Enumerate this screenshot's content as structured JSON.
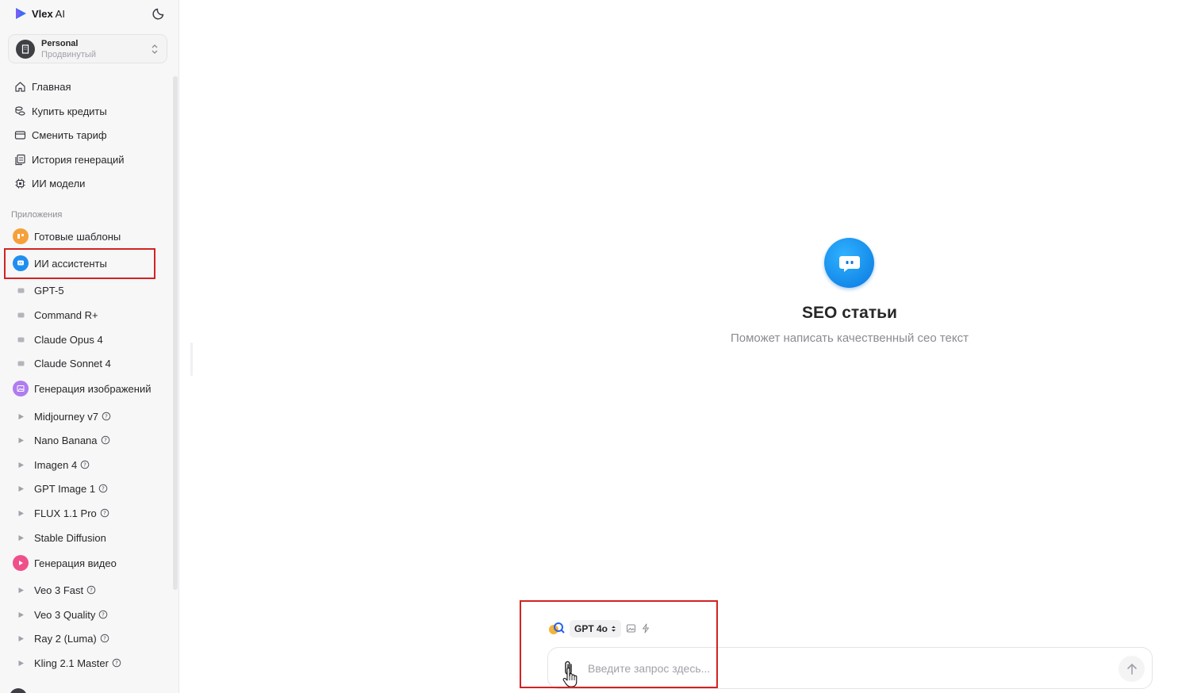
{
  "brand": {
    "name": "Vlex",
    "suffix": " AI"
  },
  "account": {
    "name": "Personal",
    "plan": "Продвинутый"
  },
  "nav": [
    {
      "label": "Главная",
      "icon": "home-icon"
    },
    {
      "label": "Купить кредиты",
      "icon": "coins-icon"
    },
    {
      "label": "Сменить тариф",
      "icon": "card-icon"
    },
    {
      "label": "История генераций",
      "icon": "history-icon"
    },
    {
      "label": "ИИ модели",
      "icon": "chip-icon"
    }
  ],
  "apps": {
    "section_label": "Приложения",
    "templates": {
      "label": "Готовые шаблоны",
      "color": "#f5a03a"
    },
    "assistants": {
      "label": "ИИ ассистенты",
      "color": "#1f8ef1"
    },
    "assistant_items": [
      "GPT-5",
      "Command R+",
      "Claude Opus 4",
      "Claude Sonnet 4"
    ],
    "images": {
      "label": "Генерация изображений",
      "color": "#b07cf0"
    },
    "image_items": [
      "Midjourney v7",
      "Nano Banana",
      "Imagen 4",
      "GPT Image 1",
      "FLUX 1.1 Pro",
      "Stable Diffusion"
    ],
    "video": {
      "label": "Генерация видео",
      "color": "#f0508a"
    },
    "video_items": [
      "Veo 3 Fast",
      "Veo 3 Quality",
      "Ray 2 (Luma)",
      "Kling 2.1 Master"
    ]
  },
  "main": {
    "title": "SEO статьи",
    "subtitle": "Поможет написать качественный сео текст"
  },
  "composer": {
    "model": "GPT 4o",
    "placeholder": "Введите запрос здесь..."
  },
  "colors": {
    "accent": "#1f8ef1",
    "highlight": "#d32222"
  }
}
